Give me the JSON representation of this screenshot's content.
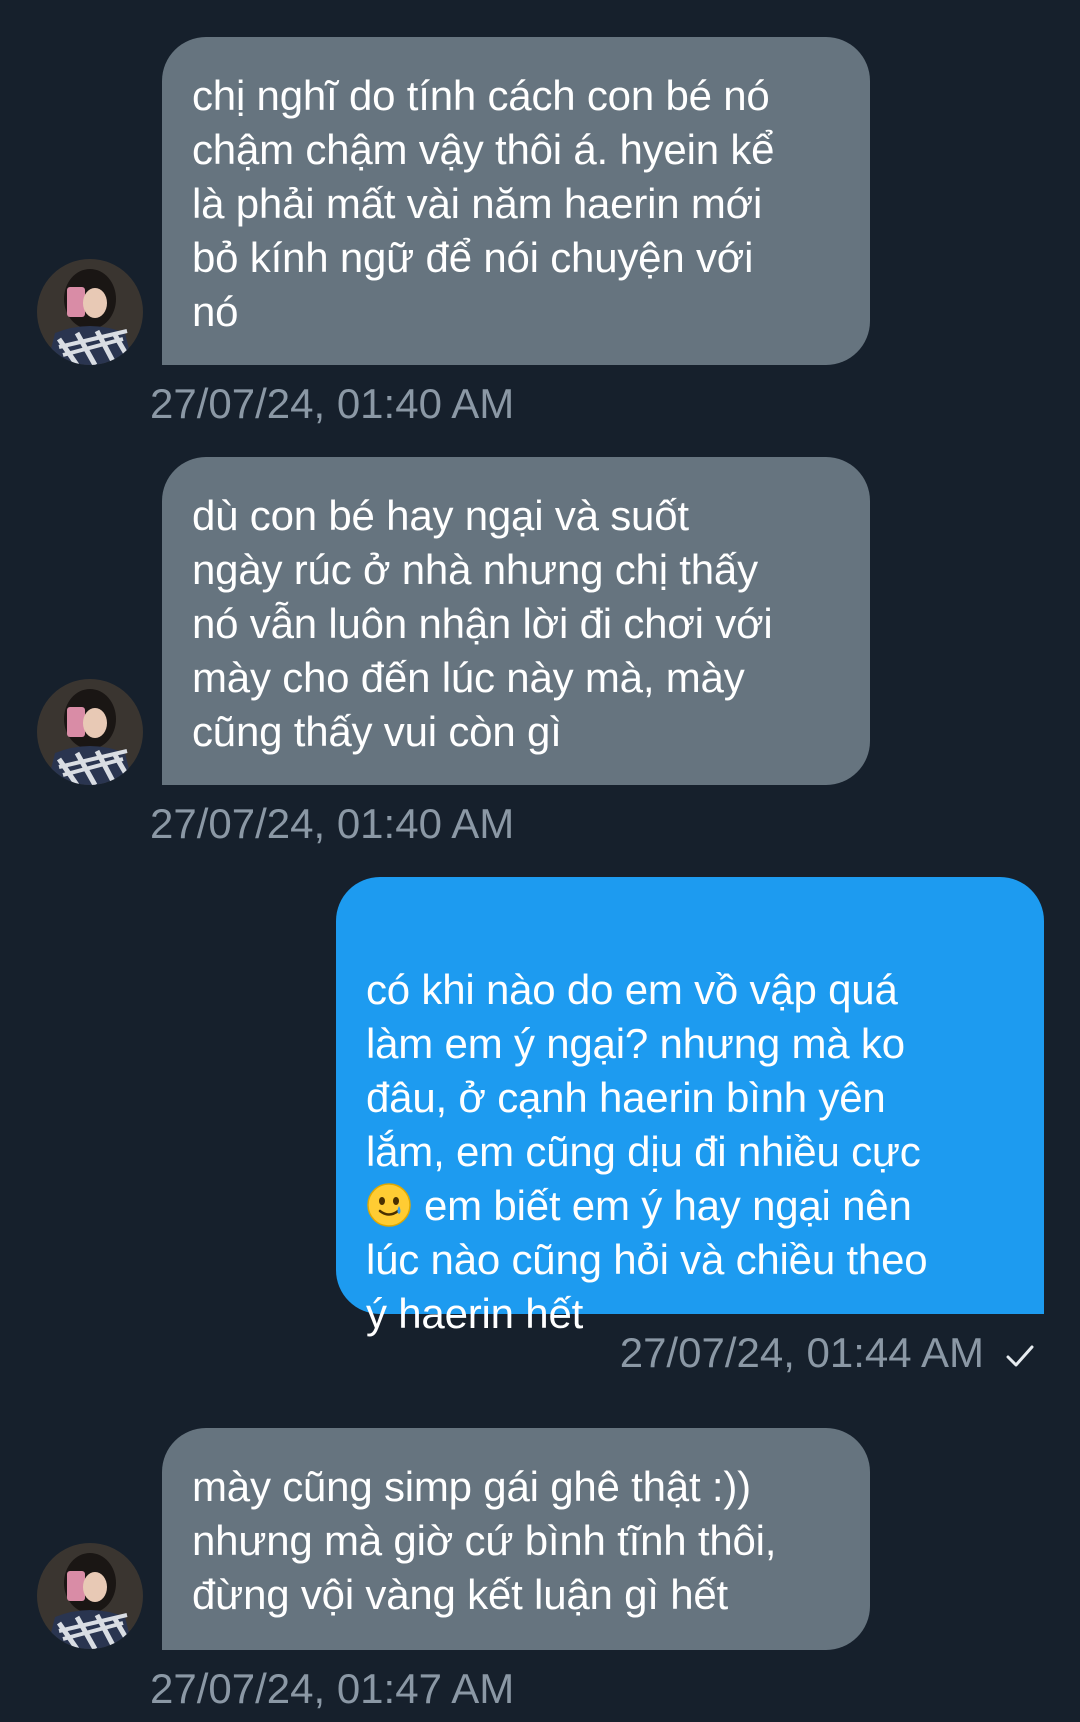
{
  "messages": [
    {
      "direction": "in",
      "text": "chị nghĩ do tính cách con bé nó\nchậm chậm vậy thôi á. hyein kể\nlà phải mất vài năm haerin mới\nbỏ kính ngữ để nói chuyện với\nnó",
      "time": "27/07/24, 01:40 AM"
    },
    {
      "direction": "in",
      "text": "dù con bé hay ngại và suốt\nngày rúc ở nhà nhưng chị thấy\nnó vẫn luôn nhận lời đi chơi với\nmày cho đến lúc này mà, mày\ncũng thấy vui còn gì",
      "time": "27/07/24, 01:40 AM"
    },
    {
      "direction": "out",
      "text_before_emoji": "có khi nào do em vồ vập quá\nlàm em ý ngại? nhưng mà ko\nđâu, ở cạnh haerin bình yên\nlắm, em cũng dịu đi nhiều cực\n",
      "emoji": "smiling-face-with-tear",
      "text_after_emoji": "em biết em ý hay ngại nên\nlúc nào cũng hỏi và chiều theo\ný haerin hết",
      "time": "27/07/24, 01:44 AM",
      "status_icon": "check-icon"
    },
    {
      "direction": "in",
      "text": "mày cũng simp gái ghê thật :))\nnhưng mà giờ cứ bình tĩnh thôi,\nđừng vội vàng kết luận gì hết",
      "time": "27/07/24, 01:47 AM"
    }
  ],
  "colors": {
    "background": "#16202c",
    "incoming_bubble": "#66747f",
    "outgoing_bubble": "#1d9bf0",
    "timestamp": "#8b98a5"
  }
}
